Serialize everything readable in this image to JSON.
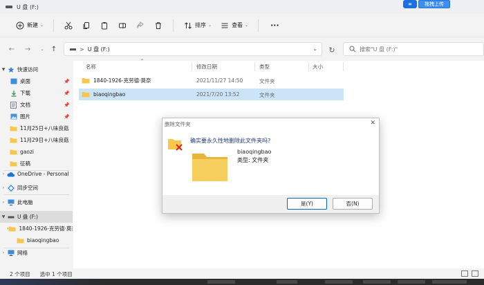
{
  "window": {
    "title": "U 盘 (F:)"
  },
  "badge": {
    "button_label": "拖拽上传"
  },
  "toolbar": {
    "new_label": "新建",
    "sort_label": "排序",
    "view_label": "查看",
    "more_label": "···"
  },
  "address": {
    "path": "U 盘 (F:)",
    "separator": ">"
  },
  "search": {
    "placeholder": "搜索\"U 盘 (F:)\""
  },
  "sidebar": {
    "items": [
      {
        "label": "快速访问",
        "icon": "star-icon"
      },
      {
        "label": "桌面",
        "icon": "desktop-icon"
      },
      {
        "label": "下载",
        "icon": "download-icon"
      },
      {
        "label": "文档",
        "icon": "document-icon"
      },
      {
        "label": "图片",
        "icon": "picture-icon"
      },
      {
        "label": "11月25日+八味良菇",
        "icon": "folder-icon"
      },
      {
        "label": "11月29日+八味良菇",
        "icon": "folder-icon"
      },
      {
        "label": "gaozi",
        "icon": "folder-icon"
      },
      {
        "label": "征稿",
        "icon": "folder-icon"
      },
      {
        "label": "OneDrive - Personal",
        "icon": "cloud-icon"
      },
      {
        "label": "同步空间",
        "icon": "sync-icon"
      },
      {
        "label": "此电脑",
        "icon": "pc-icon"
      },
      {
        "label": "U 盘 (F:)",
        "icon": "drive-icon"
      },
      {
        "label": "1840-1926-克劳德·莫奈",
        "icon": "folder-icon"
      },
      {
        "label": "biaoqingbao",
        "icon": "folder-icon"
      },
      {
        "label": "网络",
        "icon": "network-icon"
      }
    ]
  },
  "columns": {
    "name": "名称",
    "modified": "修改日期",
    "type": "类型",
    "size": "大小"
  },
  "files": [
    {
      "name": "1840-1926-克劳德·莫奈",
      "modified": "2021/11/27 14:50",
      "type": "文件夹",
      "size": ""
    },
    {
      "name": "biaoqingbao",
      "modified": "2021/7/20 13:52",
      "type": "文件夹",
      "size": ""
    }
  ],
  "dialog": {
    "title": "删除文件夹",
    "question": "确实要永久性地删除此文件夹吗?",
    "item_name": "biaoqingbao",
    "item_type": "类型: 文件夹",
    "yes_label": "是(Y)",
    "no_label": "否(N)"
  },
  "status": {
    "count": "2 个项目",
    "selected": "选中 1 个项目"
  },
  "colors": {
    "accent": "#0067c0",
    "folder": "#f5c84c",
    "selection": "#cce4f7"
  }
}
